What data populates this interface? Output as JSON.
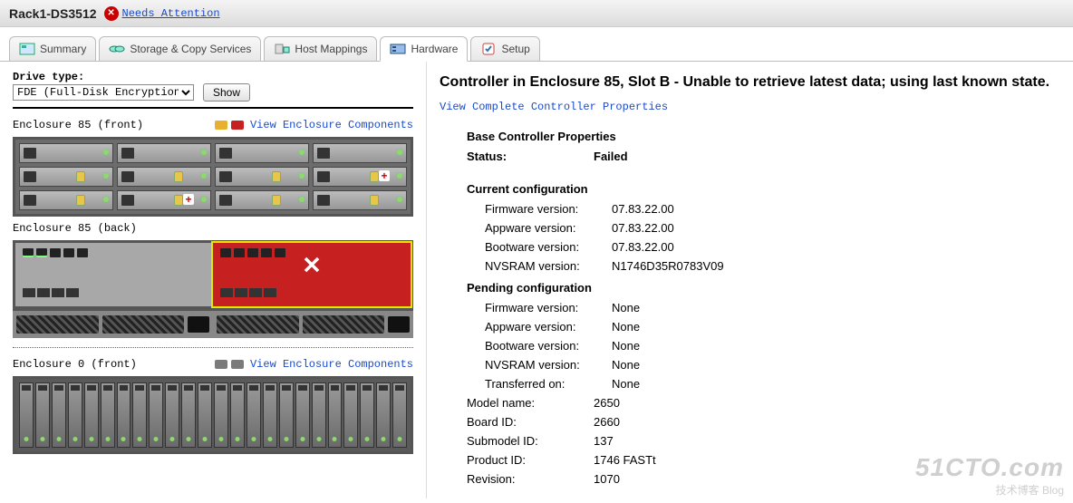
{
  "header": {
    "device_name": "Rack1-DS3512",
    "attention_text": "Needs Attention"
  },
  "tabs": [
    {
      "label": "Summary"
    },
    {
      "label": "Storage & Copy Services"
    },
    {
      "label": "Host Mappings"
    },
    {
      "label": "Hardware"
    },
    {
      "label": "Setup"
    }
  ],
  "drive_type": {
    "label": "Drive type:",
    "selected": "FDE (Full-Disk Encryption)",
    "show_label": "Show"
  },
  "enclosures": {
    "e85_front": {
      "title": "Enclosure 85 (front)",
      "link": "View Enclosure Components"
    },
    "e85_back": {
      "title": "Enclosure 85 (back)"
    },
    "e0_front": {
      "title": "Enclosure 0 (front)",
      "link": "View Enclosure Components"
    }
  },
  "detail": {
    "title": "Controller in Enclosure 85, Slot B - Unable to retrieve latest data; using last known state.",
    "view_link": "View Complete Controller Properties",
    "base_heading": "Base Controller Properties",
    "status_label": "Status:",
    "status_value": "Failed",
    "current_heading": "Current configuration",
    "pending_heading": "Pending configuration",
    "rows_current": [
      {
        "label": "Firmware version:",
        "value": "07.83.22.00"
      },
      {
        "label": "Appware version:",
        "value": "07.83.22.00"
      },
      {
        "label": "Bootware version:",
        "value": "07.83.22.00"
      },
      {
        "label": "NVSRAM version:",
        "value": "N1746D35R0783V09"
      }
    ],
    "rows_pending": [
      {
        "label": "Firmware version:",
        "value": "None"
      },
      {
        "label": "Appware version:",
        "value": "None"
      },
      {
        "label": "Bootware version:",
        "value": "None"
      },
      {
        "label": "NVSRAM version:",
        "value": "None"
      },
      {
        "label": "Transferred on:",
        "value": "None"
      }
    ],
    "rows_general": [
      {
        "label": "Model name:",
        "value": "2650"
      },
      {
        "label": "Board ID:",
        "value": "2660"
      },
      {
        "label": "Submodel ID:",
        "value": "137"
      },
      {
        "label": "Product ID:",
        "value": "1746 FASTt"
      },
      {
        "label": "Revision:",
        "value": "1070"
      }
    ]
  },
  "watermark": {
    "big": "51CTO.com",
    "small": "技术博客  Blog"
  }
}
